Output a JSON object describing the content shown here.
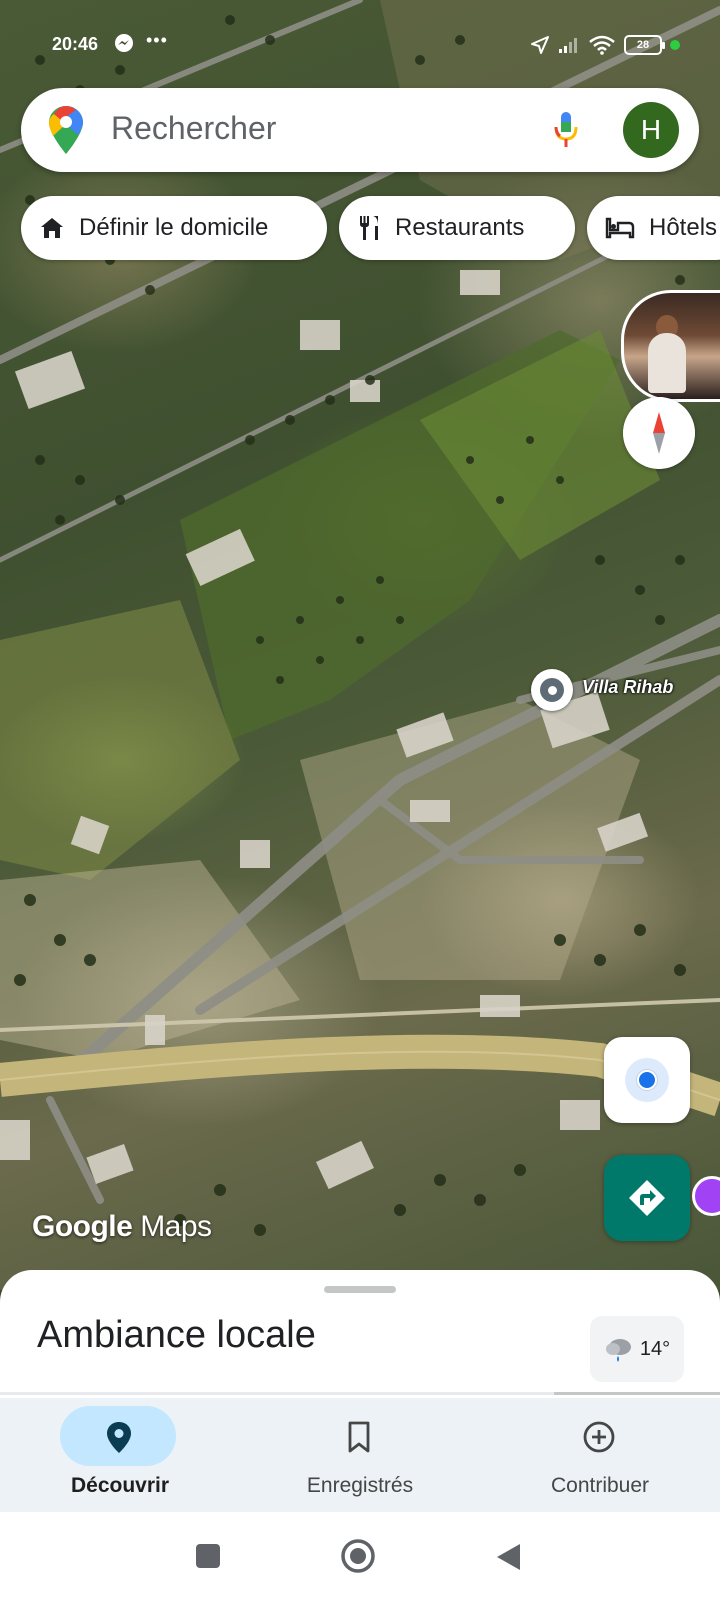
{
  "status_bar": {
    "time": "20:46",
    "dots": "•••",
    "battery": "28",
    "icons": [
      "messenger-icon",
      "location-arrow-icon",
      "signal-icon",
      "wifi-icon",
      "battery-icon",
      "green-dot-indicator"
    ]
  },
  "search": {
    "placeholder": "Rechercher",
    "avatar_letter": "H",
    "avatar_color": "#33691e"
  },
  "chips": [
    {
      "label": "Définir le domicile",
      "icon": "home-icon"
    },
    {
      "label": "Restaurants",
      "icon": "restaurant-icon"
    },
    {
      "label": "Hôtels",
      "icon": "hotel-icon"
    }
  ],
  "map": {
    "place_label": "Villa Rihab",
    "watermark_google": "Google",
    "watermark_maps": "Maps"
  },
  "sheet": {
    "title": "Ambiance locale",
    "weather_temp": "14°"
  },
  "bottom_nav": [
    {
      "label": "Découvrir",
      "icon": "explore-pin-icon",
      "active": true
    },
    {
      "label": "Enregistrés",
      "icon": "bookmark-icon",
      "active": false
    },
    {
      "label": "Contribuer",
      "icon": "add-circle-icon",
      "active": false
    }
  ],
  "colors": {
    "accent_blue": "#1a73e8",
    "directions_teal": "#00796b",
    "nav_active_pill": "#c2e7ff"
  }
}
